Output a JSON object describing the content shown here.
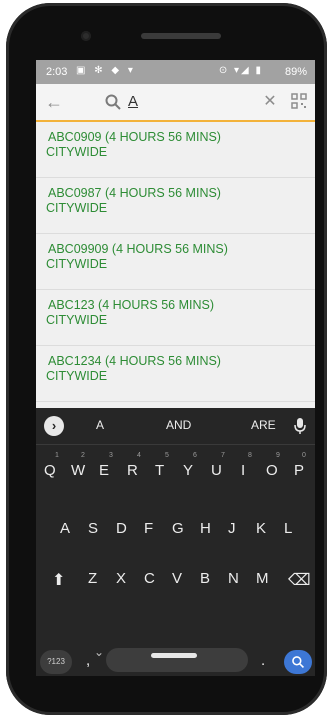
{
  "status": {
    "time": "2:03",
    "left_icons": "▣ ✻ ◆ ▾",
    "right_icons": "⊙ ▾◢ ▮",
    "battery": "89%"
  },
  "search": {
    "query": "A",
    "back_icon": "arrow-left",
    "clear_icon": "close",
    "qr_icon": "qr-code"
  },
  "results": [
    {
      "name": "ABC0909 (4 HOURS 56 MINS)",
      "location": "CITYWIDE"
    },
    {
      "name": "ABC0987 (4 HOURS 56 MINS)",
      "location": "CITYWIDE"
    },
    {
      "name": "ABC09909 (4 HOURS 56 MINS)",
      "location": "CITYWIDE"
    },
    {
      "name": "ABC123 (4 HOURS 56 MINS)",
      "location": "CITYWIDE"
    },
    {
      "name": "ABC1234 (4 HOURS 56 MINS)",
      "location": "CITYWIDE"
    }
  ],
  "keyboard": {
    "suggestions": [
      "A",
      "AND",
      "ARE"
    ],
    "row1": [
      "Q",
      "W",
      "E",
      "R",
      "T",
      "Y",
      "U",
      "I",
      "O",
      "P"
    ],
    "row1_hints": [
      "1",
      "2",
      "3",
      "4",
      "5",
      "6",
      "7",
      "8",
      "9",
      "0"
    ],
    "row2": [
      "A",
      "S",
      "D",
      "F",
      "G",
      "H",
      "J",
      "K",
      "L"
    ],
    "row3": [
      "Z",
      "X",
      "C",
      "V",
      "B",
      "N",
      "M"
    ],
    "symbols_label": "?123",
    "comma": ",",
    "period": "."
  },
  "colors": {
    "accent_orange": "#f3b23a",
    "result_text": "#2d8c35",
    "keyboard_bg": "#262626",
    "enter_key": "#3d77d5"
  }
}
